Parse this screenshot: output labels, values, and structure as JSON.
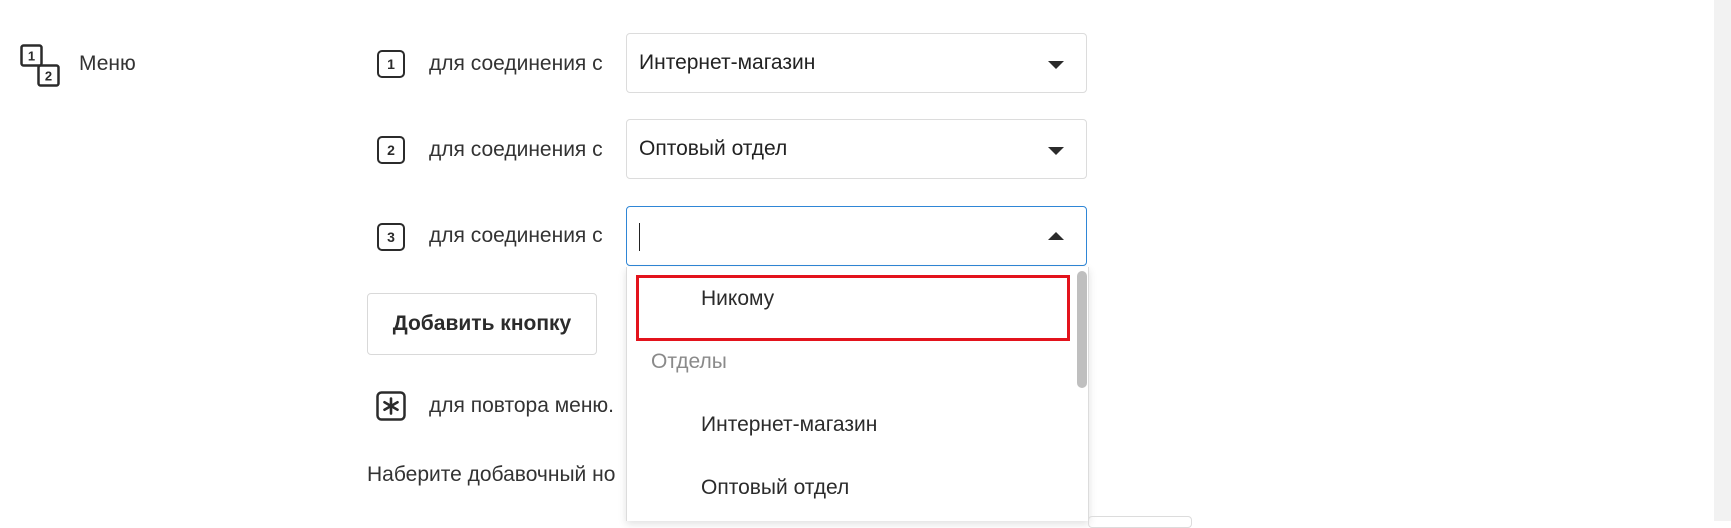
{
  "menu": {
    "label": "Меню",
    "icon": "menu-numbered-icon"
  },
  "rows": [
    {
      "key": "1",
      "text": "для соединения с",
      "selected": "Интернет-магазин"
    },
    {
      "key": "2",
      "text": "для соединения с",
      "selected": "Оптовый отдел"
    },
    {
      "key": "3",
      "text": "для соединения с",
      "selected": ""
    }
  ],
  "add_button": {
    "label": "Добавить кнопку"
  },
  "repeat_row": {
    "key_icon": "asterisk-icon",
    "text": "для повтора меню."
  },
  "extension_hint": "Наберите добавочный но",
  "dropdown": {
    "items": [
      {
        "label": "Никому",
        "highlighted": true
      },
      {
        "label": "Отделы",
        "group": true
      },
      {
        "label": "Интернет-магазин"
      },
      {
        "label": "Оптовый отдел"
      }
    ]
  },
  "colors": {
    "focus_border": "#2f86d6",
    "highlight": "#e3131c"
  }
}
